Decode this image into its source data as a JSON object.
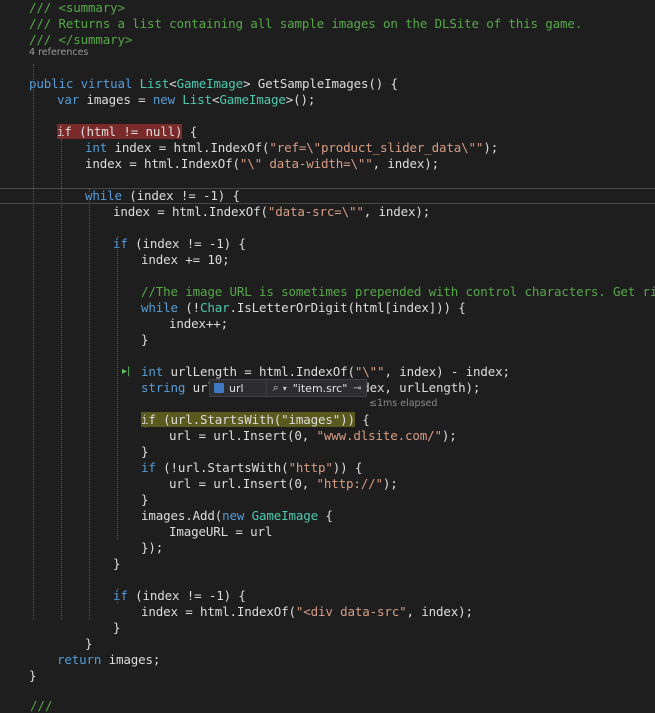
{
  "editor": {
    "colors": {
      "background": "#1e1e1e",
      "keyword": "#569cd6",
      "type": "#4ec9b0",
      "string": "#d69d85",
      "comment": "#57a64a",
      "number": "#b5cea8",
      "breakpoint_highlight": "#7a2a2a",
      "current_statement_highlight": "#5a5a1e"
    },
    "codelens": "4 references",
    "lines": [
      [
        [
          "c",
          "/// <summary>"
        ]
      ],
      [
        [
          "c",
          "/// Returns a list containing all sample images on the DLSite of this game."
        ]
      ],
      [
        [
          "c",
          "/// </summary>"
        ]
      ],
      [
        [
          "k",
          "public "
        ],
        [
          "k",
          "virtual "
        ],
        [
          "t",
          "List"
        ],
        [
          "p",
          "<"
        ],
        [
          "t",
          "GameImage"
        ],
        [
          "p",
          "> GetSampleImages() {"
        ]
      ],
      [
        [
          "k",
          "var "
        ],
        [
          "p",
          "images = "
        ],
        [
          "k",
          "new "
        ],
        [
          "t",
          "List"
        ],
        [
          "p",
          "<"
        ],
        [
          "t",
          "GameImage"
        ],
        [
          "p",
          ">();"
        ]
      ],
      [],
      [
        [
          "bp",
          "if (html != null)"
        ],
        [
          "p",
          " {"
        ]
      ],
      [
        [
          "k",
          "int "
        ],
        [
          "p",
          "index = html.IndexOf("
        ],
        [
          "s",
          "\"ref=\\\"product_slider_data\\\"\""
        ],
        [
          "p",
          ");"
        ]
      ],
      [
        [
          "p",
          "index = html.IndexOf("
        ],
        [
          "s",
          "\"\\\" data-width=\\\"\""
        ],
        [
          "p",
          ", index);"
        ]
      ],
      [],
      [
        [
          "k",
          "while "
        ],
        [
          "p",
          "(index != -1) {"
        ]
      ],
      [
        [
          "p",
          "index = html.IndexOf("
        ],
        [
          "s",
          "\"data-src=\\\"\""
        ],
        [
          "p",
          ", index);"
        ]
      ],
      [],
      [
        [
          "k",
          "if "
        ],
        [
          "p",
          "(index != -1) {"
        ]
      ],
      [
        [
          "p",
          "index += 10;"
        ]
      ],
      [],
      [
        [
          "c",
          "//The image URL is sometimes prepended with control characters. Get rid of"
        ]
      ],
      [
        [
          "k",
          "while "
        ],
        [
          "p",
          "(!"
        ],
        [
          "t",
          "Char"
        ],
        [
          "p",
          ".IsLetterOrDigit(html[index])) {"
        ]
      ],
      [
        [
          "p",
          "index++;"
        ]
      ],
      [
        [
          "p",
          "}"
        ]
      ],
      [],
      [
        [
          "k",
          "int "
        ],
        [
          "p",
          "urlLength = html.IndexOf("
        ],
        [
          "s",
          "\"\\\"\""
        ],
        [
          "p",
          ", index) - index;"
        ]
      ],
      [
        [
          "k",
          "string "
        ],
        [
          "p",
          "url = html.Substring(index, urlLength);"
        ]
      ],
      [],
      [
        [
          "cur",
          "if (url.StartsWith(\"images\"))"
        ],
        [
          "p",
          " {"
        ]
      ],
      [
        [
          "p",
          "url = url.Insert(0, "
        ],
        [
          "s",
          "\"www.dlsite.com/\""
        ],
        [
          "p",
          ");"
        ]
      ],
      [
        [
          "p",
          "}"
        ]
      ],
      [
        [
          "k",
          "if "
        ],
        [
          "p",
          "(!url.StartsWith("
        ],
        [
          "s",
          "\"http\""
        ],
        [
          "p",
          ")) {"
        ]
      ],
      [
        [
          "p",
          "url = url.Insert(0, "
        ],
        [
          "s",
          "\"http://\""
        ],
        [
          "p",
          ");"
        ]
      ],
      [
        [
          "p",
          "}"
        ]
      ],
      [
        [
          "p",
          "images.Add("
        ],
        [
          "k",
          "new "
        ],
        [
          "t",
          "GameImage"
        ],
        [
          "p",
          " {"
        ]
      ],
      [
        [
          "p",
          "ImageURL = url"
        ]
      ],
      [
        [
          "p",
          "});"
        ]
      ],
      [
        [
          "p",
          "}"
        ]
      ],
      [],
      [
        [
          "k",
          "if "
        ],
        [
          "p",
          "(index != -1) {"
        ]
      ],
      [
        [
          "p",
          "index = html.IndexOf("
        ],
        [
          "s",
          "\"<div data-src\""
        ],
        [
          "p",
          ", index);"
        ]
      ],
      [
        [
          "p",
          "}"
        ]
      ],
      [
        [
          "p",
          "}"
        ]
      ],
      [
        [
          "k",
          "return "
        ],
        [
          "p",
          "images;"
        ]
      ],
      [
        [
          "p",
          "}"
        ]
      ]
    ]
  },
  "datatip": {
    "variable": "url",
    "value": "\"item.src\"",
    "icon": "field-icon",
    "search_icon": "magnifier-icon",
    "pin_icon": "pin-icon"
  },
  "perf_tip": "≤1ms elapsed",
  "bottom_fragment": "///"
}
